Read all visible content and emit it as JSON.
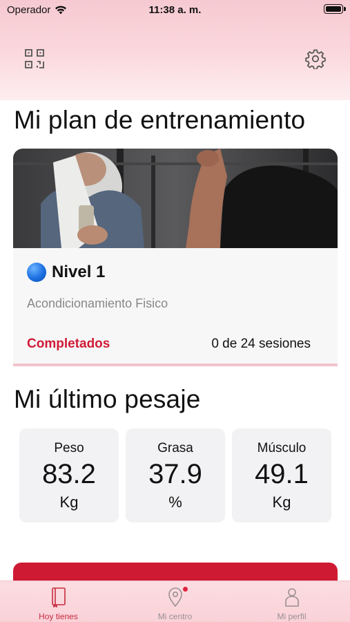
{
  "status_bar": {
    "carrier": "Operador",
    "time": "11:38 a. m."
  },
  "header": {
    "qr_icon": "qr-code-icon",
    "settings_icon": "gear-icon"
  },
  "plan_section": {
    "title": "Mi plan de entrenamiento",
    "card": {
      "level_icon": "blue-circle-icon",
      "level": "Nivel 1",
      "subtitle": "Acondicionamiento Fisico",
      "completed_label": "Completados",
      "sessions": "0 de 24 sesiones"
    }
  },
  "weigh_section": {
    "title": "Mi último pesaje",
    "metrics": [
      {
        "label": "Peso",
        "value": "83.2",
        "unit": "Kg"
      },
      {
        "label": "Grasa",
        "value": "37.9",
        "unit": "%"
      },
      {
        "label": "Músculo",
        "value": "49.1",
        "unit": "Kg"
      }
    ]
  },
  "tab_bar": {
    "items": [
      {
        "label": "Hoy tienes",
        "icon": "book-icon",
        "active": true
      },
      {
        "label": "Mi centro",
        "icon": "location-pin-icon",
        "active": false,
        "badge": true
      },
      {
        "label": "Mi perfil",
        "icon": "person-icon",
        "active": false
      }
    ]
  },
  "colors": {
    "accent": "#cf1a33",
    "header_tint": "#f6c9d0",
    "card_bg": "#f2f2f4"
  }
}
